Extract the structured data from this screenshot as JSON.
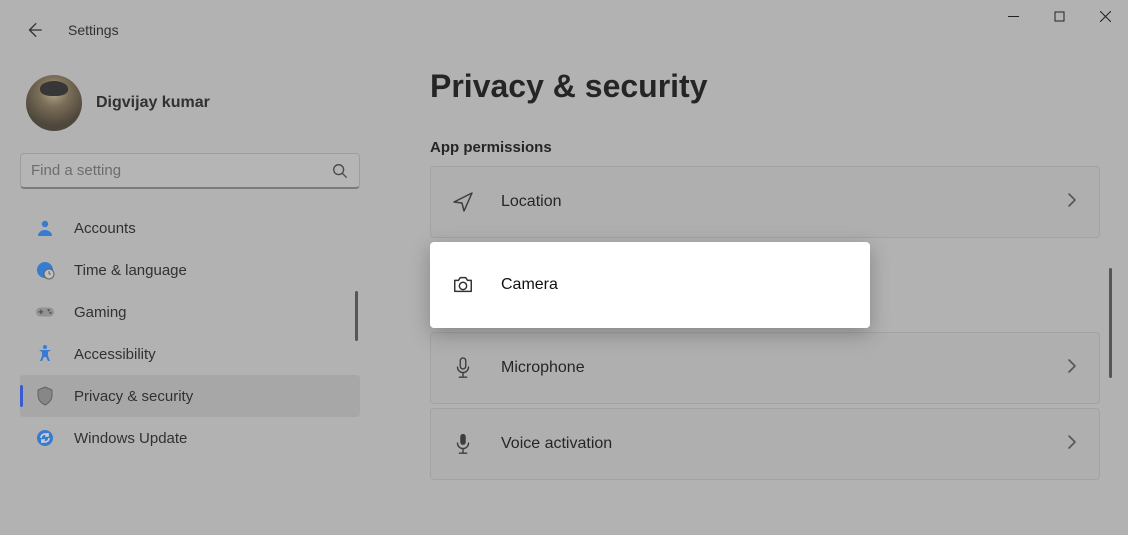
{
  "window": {
    "app_title": "Settings"
  },
  "profile": {
    "name": "Digvijay kumar"
  },
  "search": {
    "placeholder": "Find a setting"
  },
  "sidebar": {
    "items": [
      {
        "label": "Accounts",
        "icon": "person-icon"
      },
      {
        "label": "Time & language",
        "icon": "globe-clock-icon"
      },
      {
        "label": "Gaming",
        "icon": "gamepad-icon"
      },
      {
        "label": "Accessibility",
        "icon": "accessibility-icon"
      },
      {
        "label": "Privacy & security",
        "icon": "shield-icon",
        "active": true
      },
      {
        "label": "Windows Update",
        "icon": "update-icon"
      }
    ]
  },
  "main": {
    "title": "Privacy & security",
    "section": "App permissions",
    "permissions": [
      {
        "label": "Location",
        "icon": "location-icon"
      },
      {
        "label": "Camera",
        "icon": "camera-icon",
        "highlight": true
      },
      {
        "label": "Microphone",
        "icon": "microphone-icon"
      },
      {
        "label": "Voice activation",
        "icon": "voice-icon"
      }
    ]
  },
  "colors": {
    "accent": "#2a5fff",
    "highlight_bg": "#ffffff",
    "dim_overlay": "rgba(90,90,90,0.28)"
  }
}
